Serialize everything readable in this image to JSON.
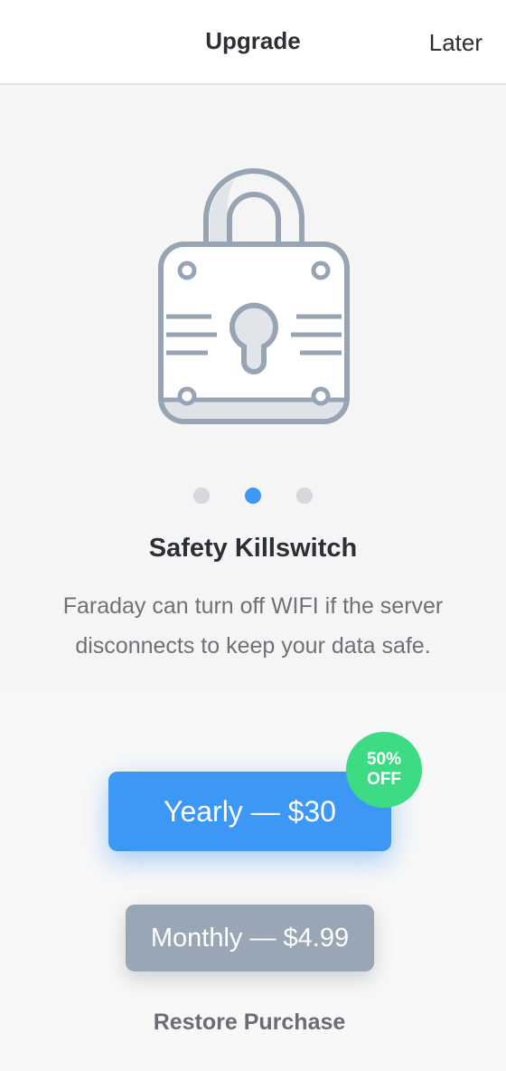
{
  "header": {
    "title": "Upgrade",
    "later_label": "Later"
  },
  "carousel": {
    "current_page": 2,
    "total_pages": 3,
    "icon": "padlock-icon",
    "title": "Safety Killswitch",
    "description": "Faraday can turn off WIFI if the server disconnects to keep your data safe."
  },
  "plans": {
    "yearly_label": "Yearly — $30",
    "badge_line1": "50%",
    "badge_line2": "OFF",
    "monthly_label": "Monthly — $4.99",
    "restore_label": "Restore Purchase"
  },
  "colors": {
    "accent": "#3d97f5",
    "badge": "#3ddc84",
    "secondary_button": "#98a6b5",
    "icon_stroke": "#96a4b3"
  }
}
